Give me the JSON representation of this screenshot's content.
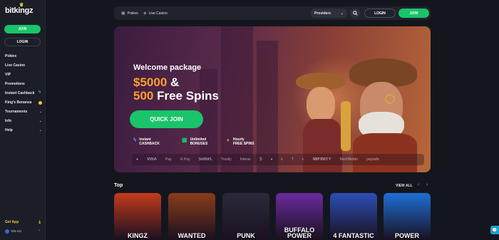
{
  "brand": {
    "logo_text": "bitkingz"
  },
  "sidebar": {
    "join_label": "JOIN",
    "login_label": "LOGIN",
    "items": [
      {
        "label": "Pokies",
        "marker": ""
      },
      {
        "label": "Live Casino",
        "marker": ""
      },
      {
        "label": "VIP",
        "marker": ""
      },
      {
        "label": "Promotions",
        "marker": ""
      },
      {
        "label": "Instant Cashback",
        "marker": "bolt-icon"
      },
      {
        "label": "King's Bonanza",
        "marker": "coin-icon"
      },
      {
        "label": "Tournaments",
        "marker": "chevron-down-icon"
      },
      {
        "label": "Info",
        "marker": "chevron-down-icon"
      },
      {
        "label": "Help",
        "marker": "chevron-down-icon"
      }
    ],
    "get_app_label": "Get App",
    "language_label": "EN-AU"
  },
  "topbar": {
    "pokies_label": "Pokies",
    "live_casino_label": "Live Casino",
    "providers_label": "Providers",
    "login_label": "LOGIN",
    "join_label": "JOIN"
  },
  "banner": {
    "welcome": "Welcome package",
    "amount_orange": "$5000",
    "amount_white": " &",
    "spins_orange": "500",
    "spins_white": " Free Spins",
    "cta_label": "QUICK JOIN",
    "perks": [
      {
        "title": "Instant",
        "sub": "CASHBACK",
        "icon": "bolt-icon"
      },
      {
        "title": "Unlimited",
        "sub": "BONUSES",
        "icon": "gift-icon"
      },
      {
        "title": "Hourly",
        "sub": "FREE SPINS",
        "icon": "spin-icon"
      }
    ],
    "payments": [
      "●",
      "VISA",
      "Pay",
      "G Pay",
      "Sofort.",
      "Trustly",
      "Interac",
      "₿",
      "♦",
      "Ł",
      "T",
      "Ł",
      "MIFINITY",
      "MuchBetter",
      "paysafe"
    ]
  },
  "top_section": {
    "title": "Top",
    "view_all_label": "VIEW ALL",
    "games": [
      {
        "title": "KINGZ",
        "bg": "#c33a1c"
      },
      {
        "title": "WANTED",
        "bg": "#8a3c1a"
      },
      {
        "title": "PUNK",
        "bg": "#2a2a3a"
      },
      {
        "title": "BUFFALO POWER",
        "bg": "#6a2b9e"
      },
      {
        "title": "4 FANTASTIC",
        "bg": "#2c4fb5"
      },
      {
        "title": "POWER",
        "bg": "#1e6fd6"
      }
    ]
  },
  "colors": {
    "accent_green": "#19c46a",
    "accent_orange": "#ff9d2e",
    "background": "#14161d"
  }
}
